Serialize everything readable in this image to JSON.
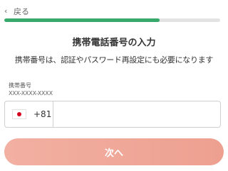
{
  "header": {
    "back_icon": "chevron-left-icon",
    "back_label": "戻る",
    "progress": 0.72
  },
  "title": "携帯電話番号の入力",
  "description": "携帯番号は、認証やパスワード再設定にも必要になります",
  "phone_field": {
    "label": "携帯番号",
    "hint": "XXX-XXXX-XXXX",
    "country_flag": "japan-flag-icon",
    "country_code": "+81",
    "value": "",
    "placeholder": ""
  },
  "next_button": {
    "label": "次へ",
    "enabled": false
  },
  "colors": {
    "progress": "#36a96b",
    "title": "#333333",
    "button": "#f2b0a2",
    "button_text": "#ffffff",
    "border": "#cfcfcf"
  }
}
